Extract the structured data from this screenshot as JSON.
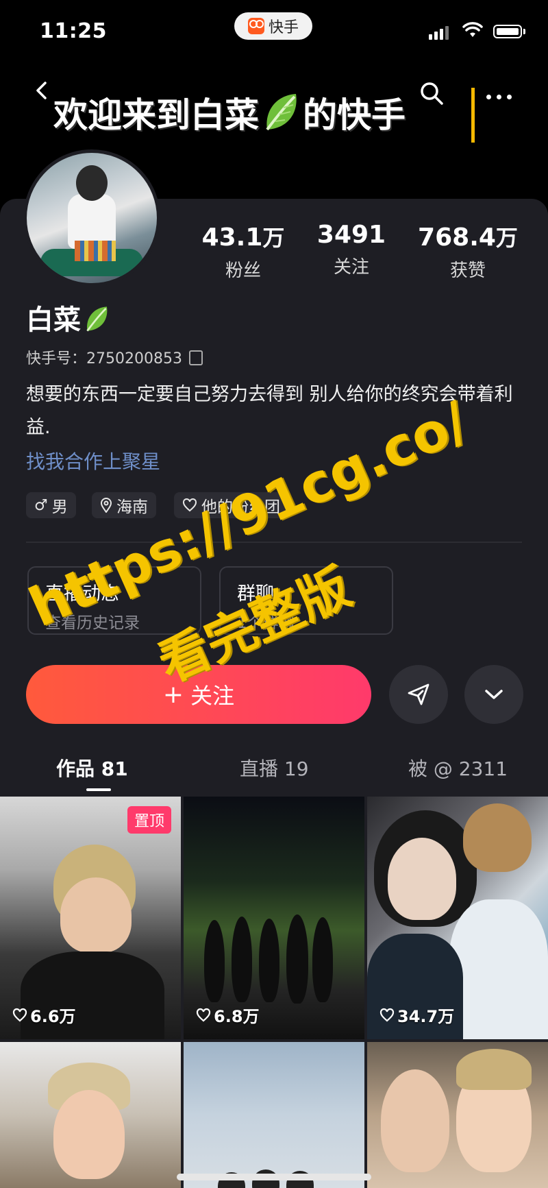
{
  "status_bar": {
    "time": "11:25",
    "app_name": "快手"
  },
  "header": {
    "title_part1": "欢迎来到白菜",
    "title_part2": "的快手"
  },
  "profile": {
    "stats": [
      {
        "number": "43.1",
        "unit": "万",
        "label": "粉丝"
      },
      {
        "number": "3491",
        "unit": "",
        "label": "关注"
      },
      {
        "number": "768.4",
        "unit": "万",
        "label": "获赞"
      }
    ],
    "name": "白菜",
    "kuaishou_id": "快手号：2750200853",
    "bio": "想要的东西一定要自己努力去得到 别人给你的终究会带着利益.",
    "cooperate_link": "找我合作上聚星",
    "tags": {
      "gender": "男",
      "location": "海南",
      "fan_group": "他的粉丝团"
    }
  },
  "panels": {
    "live": {
      "title": "直播动态",
      "subtitle": "查看历史记录"
    },
    "group": {
      "title": "群聊",
      "subtitle": "1个群聊"
    }
  },
  "actions": {
    "follow_label": "关注"
  },
  "tabs": [
    {
      "label": "作品 81"
    },
    {
      "label": "直播 19"
    },
    {
      "label": "被 @ 2311"
    }
  ],
  "grid": {
    "pinned_label": "置顶",
    "items": [
      {
        "likes": "6.6万"
      },
      {
        "likes": "6.8万"
      },
      {
        "likes": "34.7万"
      }
    ]
  },
  "watermark": {
    "url": "https://91cg.co/",
    "text": "看完整版"
  },
  "colors": {
    "accent": "#ff3a6b",
    "link": "#6f8fc9",
    "watermark": "#f5c400",
    "card_bg": "#1e1e24"
  }
}
